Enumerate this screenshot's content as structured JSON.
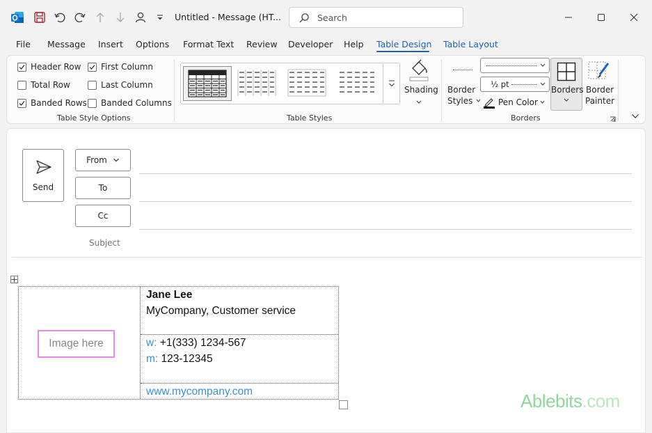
{
  "window": {
    "title": "Untitled  -  Message (HT...",
    "search_placeholder": "Search"
  },
  "menu": {
    "tabs": [
      "File",
      "Message",
      "Insert",
      "Options",
      "Format Text",
      "Review",
      "Developer",
      "Help",
      "Table Design",
      "Table Layout"
    ],
    "active_tab": "Table Design"
  },
  "ribbon": {
    "table_style_options": {
      "label": "Table Style Options",
      "options": [
        {
          "label": "Header Row",
          "checked": true
        },
        {
          "label": "First Column",
          "checked": true
        },
        {
          "label": "Total Row",
          "checked": false
        },
        {
          "label": "Last Column",
          "checked": false
        },
        {
          "label": "Banded Rows",
          "checked": true
        },
        {
          "label": "Banded Columns",
          "checked": false
        }
      ]
    },
    "table_styles": {
      "label": "Table Styles",
      "shading_label": "Shading"
    },
    "borders": {
      "label": "Borders",
      "border_styles_label_1": "Border",
      "border_styles_label_2": "Styles",
      "line_weight": "½ pt",
      "pen_color_label": "Pen Color",
      "borders_label": "Borders",
      "border_painter_label_1": "Border",
      "border_painter_label_2": "Painter"
    }
  },
  "compose": {
    "send_label": "Send",
    "from_label": "From",
    "to_label": "To",
    "cc_label": "Cc",
    "subject_label": "Subject"
  },
  "signature": {
    "image_placeholder": "Image here",
    "name": "Jane Lee",
    "company": "MyCompany, Customer service",
    "phone_prefix": "w:",
    "phone": "+1(333) 1234-567",
    "mobile_prefix": "m:",
    "mobile": "123-12345",
    "website": "www.mycompany.com"
  },
  "watermark": {
    "brand": "Ablebits",
    "suffix": ".com"
  },
  "colors": {
    "accent": "#1f62b4",
    "link": "#3c8fd0",
    "image_box": "#e18ee0",
    "watermark": "#8fd59c"
  }
}
